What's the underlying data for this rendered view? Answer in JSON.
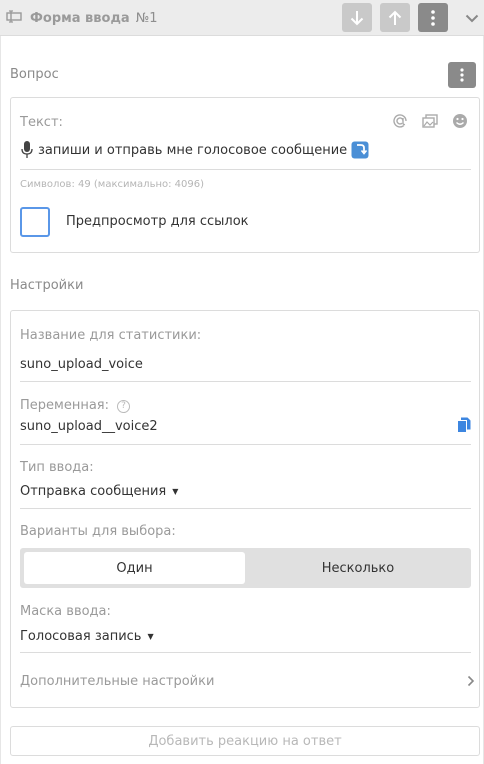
{
  "header": {
    "title": "Форма ввода",
    "number": "№1",
    "icons": {
      "form": "input-form-icon",
      "down": "arrow-down-icon",
      "up": "arrow-up-icon",
      "menu": "kebab-menu-icon",
      "collapse": "chevron-down-icon"
    }
  },
  "question": {
    "section_title": "Вопрос",
    "text_label": "Текст:",
    "text_value": "запиши и отправь мне голосовое сообщение",
    "counter": "Символов: 49 (максимально: 4096)",
    "preview_checkbox_label": "Предпросмотр для ссылок",
    "preview_checked": false
  },
  "settings": {
    "section_title": "Настройки",
    "stats_name_label": "Название для статистики:",
    "stats_name_value": "suno_upload_voice",
    "variable_label": "Переменная:",
    "variable_help": "?",
    "variable_value": "suno_upload__voice2",
    "input_type_label": "Тип ввода:",
    "input_type_value": "Отправка сообщения",
    "choice_label": "Варианты для выбора:",
    "choice_options": [
      "Один",
      "Несколько"
    ],
    "choice_selected": "Один",
    "mask_label": "Маска ввода:",
    "mask_value": "Голосовая запись",
    "advanced_label": "Дополнительные настройки"
  },
  "footer": {
    "add_reaction_label": "Добавить реакцию на ответ"
  },
  "colors": {
    "accent_blue": "#5a97e8",
    "button_gray": "#c9c9c9",
    "button_dark": "#8a8a8a"
  }
}
